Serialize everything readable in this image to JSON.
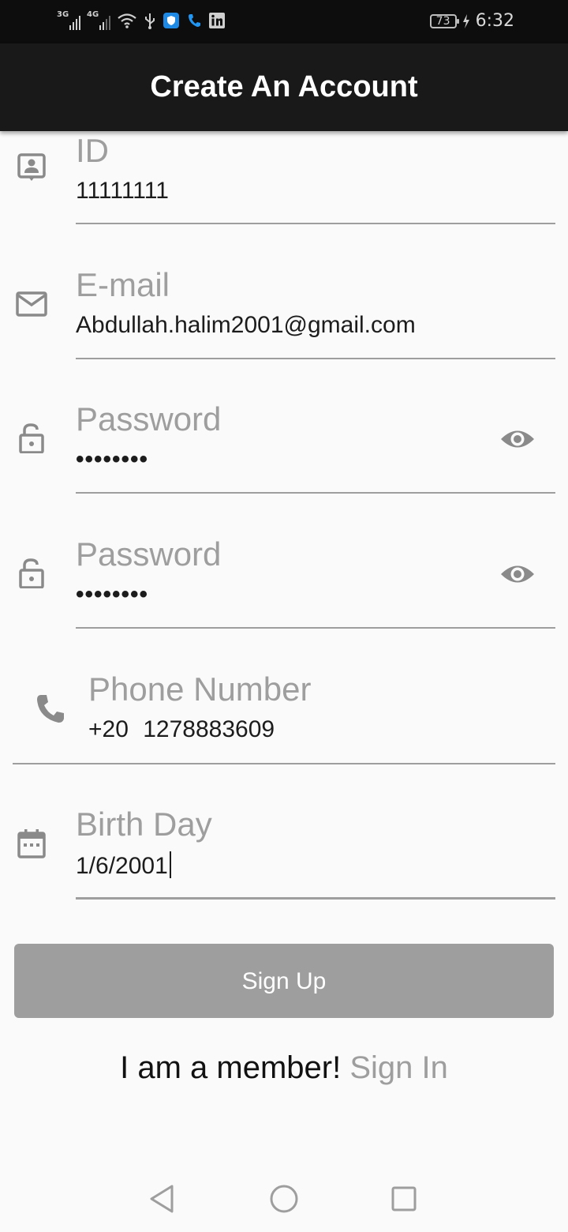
{
  "status_bar": {
    "network_1": "3G",
    "network_2": "4G",
    "battery": "73",
    "time": "6:32",
    "icons": [
      "wifi-icon",
      "usb-icon",
      "shield-app-icon",
      "phone-app-icon",
      "linkedin-icon",
      "charging-icon"
    ]
  },
  "app_bar": {
    "title": "Create An Account"
  },
  "form": {
    "id": {
      "label": "ID",
      "value": "11111111",
      "icon": "contact-id-icon"
    },
    "email": {
      "label": "E-mail",
      "value": "Abdullah.halim2001@gmail.com",
      "icon": "mail-icon"
    },
    "password": {
      "label": "Password",
      "value": "••••••••",
      "icon": "lock-icon",
      "toggle_icon": "eye-icon"
    },
    "confirm_password": {
      "label": "Password",
      "value": "••••••••",
      "icon": "lock-icon",
      "toggle_icon": "eye-icon"
    },
    "phone": {
      "label": "Phone Number",
      "prefix": "+20",
      "value": "1278883609",
      "icon": "phone-icon"
    },
    "birthday": {
      "label": "Birth Day",
      "value": "1/6/2001",
      "icon": "calendar-icon"
    }
  },
  "actions": {
    "sign_up_label": "Sign Up",
    "member_text": "I am a member!",
    "sign_in_label": "Sign In"
  },
  "colors": {
    "app_bar": "#191919",
    "background": "#fafafa",
    "muted": "#9e9e9e",
    "button": "#9e9e9e"
  },
  "nav_bar": {
    "icons": [
      "back-icon",
      "home-icon",
      "recents-icon"
    ]
  }
}
